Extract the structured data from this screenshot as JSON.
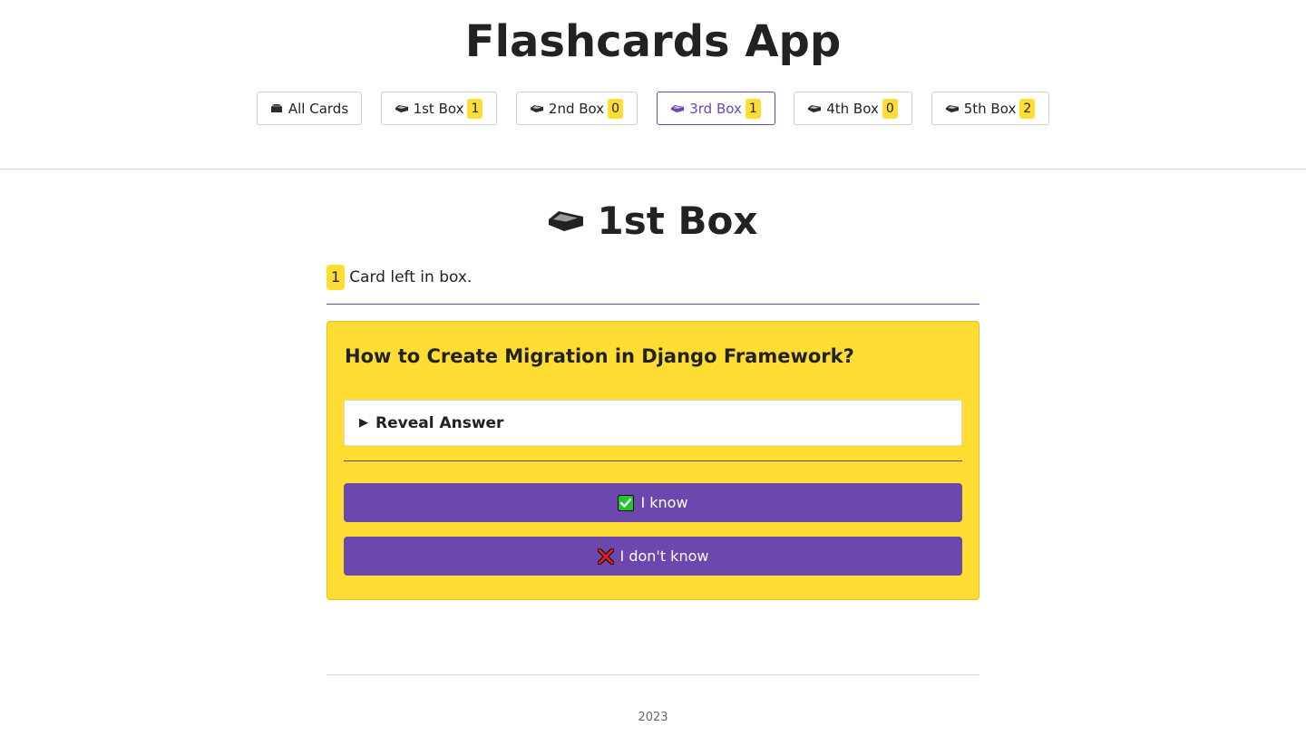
{
  "app": {
    "title": "Flashcards App"
  },
  "nav": {
    "items": [
      {
        "label": "All Cards",
        "icon": "card-file-box-icon",
        "active": false
      },
      {
        "label": "1st Box",
        "count": "1",
        "icon": "inbox-tray-icon",
        "active": false
      },
      {
        "label": "2nd Box",
        "count": "0",
        "icon": "inbox-tray-icon",
        "active": false
      },
      {
        "label": "3rd Box",
        "count": "1",
        "icon": "inbox-tray-icon",
        "active": true
      },
      {
        "label": "4th Box",
        "count": "0",
        "icon": "inbox-tray-icon",
        "active": false
      },
      {
        "label": "5th Box",
        "count": "2",
        "icon": "inbox-tray-icon",
        "active": false
      }
    ]
  },
  "box": {
    "title": "1st Box",
    "icon": "inbox-tray-icon",
    "count": "1",
    "count_text": "Card left in box."
  },
  "card": {
    "question": "How to Create Migration in Django Framework?",
    "reveal_arrow": "▶",
    "reveal_label": "Reveal Answer",
    "know_label": "I know",
    "know_icon": "check-mark-button-icon",
    "dont_know_label": "I don't know",
    "dont_know_icon": "cross-mark-icon"
  },
  "footer": {
    "year": "2023"
  },
  "colors": {
    "accent": "#6c48ae",
    "card_background": "#ffdd33",
    "badge": "#ffdd33",
    "check": "#22c52b",
    "cross": "#e02020"
  }
}
